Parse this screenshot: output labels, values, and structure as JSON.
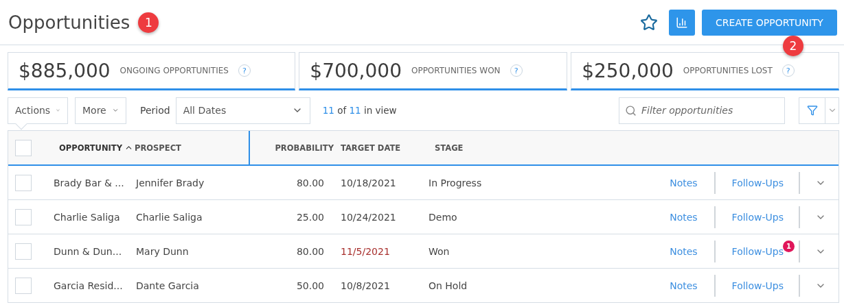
{
  "header": {
    "title": "Opportunities",
    "title_callout": "1",
    "actions": [
      {
        "kind": "favorite"
      },
      {
        "kind": "chart"
      }
    ],
    "create_button": "CREATE OPPORTUNITY",
    "create_callout": "2"
  },
  "stats": [
    {
      "amount": "$885,000",
      "label": "ONGOING OPPORTUNITIES",
      "help": "?"
    },
    {
      "amount": "$700,000",
      "label": "OPPORTUNITIES WON",
      "help": "?"
    },
    {
      "amount": "$250,000",
      "label": "OPPORTUNITIES LOST",
      "help": "?"
    }
  ],
  "toolbar": {
    "actions": "Actions",
    "more": "More",
    "period_label": "Period",
    "period_value": "All Dates",
    "view_shown": "11",
    "view_of": "of",
    "view_total": "11",
    "view_suffix": "in view",
    "search": {
      "placeholder": "Filter opportunities"
    }
  },
  "table": {
    "select_all": {
      "checked": false
    },
    "columns": [
      {
        "label": "OPPORTUNITY",
        "sorted": true
      },
      {
        "label": "PROSPECT",
        "sorted": false
      },
      {
        "label": "PROBABILITY",
        "sorted": false
      },
      {
        "label": "TARGET DATE",
        "sorted": false
      },
      {
        "label": "STAGE",
        "sorted": false
      }
    ],
    "rows": [
      {
        "checked": false,
        "opportunity": "Brady Bar & ...",
        "prospect": "Jennifer Brady",
        "probability": "80.00",
        "target_date": "10/18/2021",
        "overdue": false,
        "stage": "In Progress",
        "notes": "Notes",
        "follow_ups": "Follow-Ups"
      },
      {
        "checked": false,
        "opportunity": "Charlie Saliga",
        "prospect": "Charlie Saliga",
        "probability": "25.00",
        "target_date": "10/24/2021",
        "overdue": false,
        "stage": "Demo",
        "notes": "Notes",
        "follow_ups": "Follow-Ups"
      },
      {
        "checked": false,
        "opportunity": "Dunn & Dun...",
        "prospect": "Mary Dunn",
        "probability": "80.00",
        "target_date": "11/5/2021",
        "overdue": true,
        "stage": "Won",
        "notes": "Notes",
        "follow_ups": "Follow-Ups",
        "follow_up_count": "1"
      },
      {
        "checked": false,
        "opportunity": "Garcia Resid...",
        "prospect": "Dante Garcia",
        "probability": "50.00",
        "target_date": "10/8/2021",
        "overdue": false,
        "stage": "On Hold",
        "notes": "Notes",
        "follow_ups": "Follow-Ups"
      }
    ]
  }
}
